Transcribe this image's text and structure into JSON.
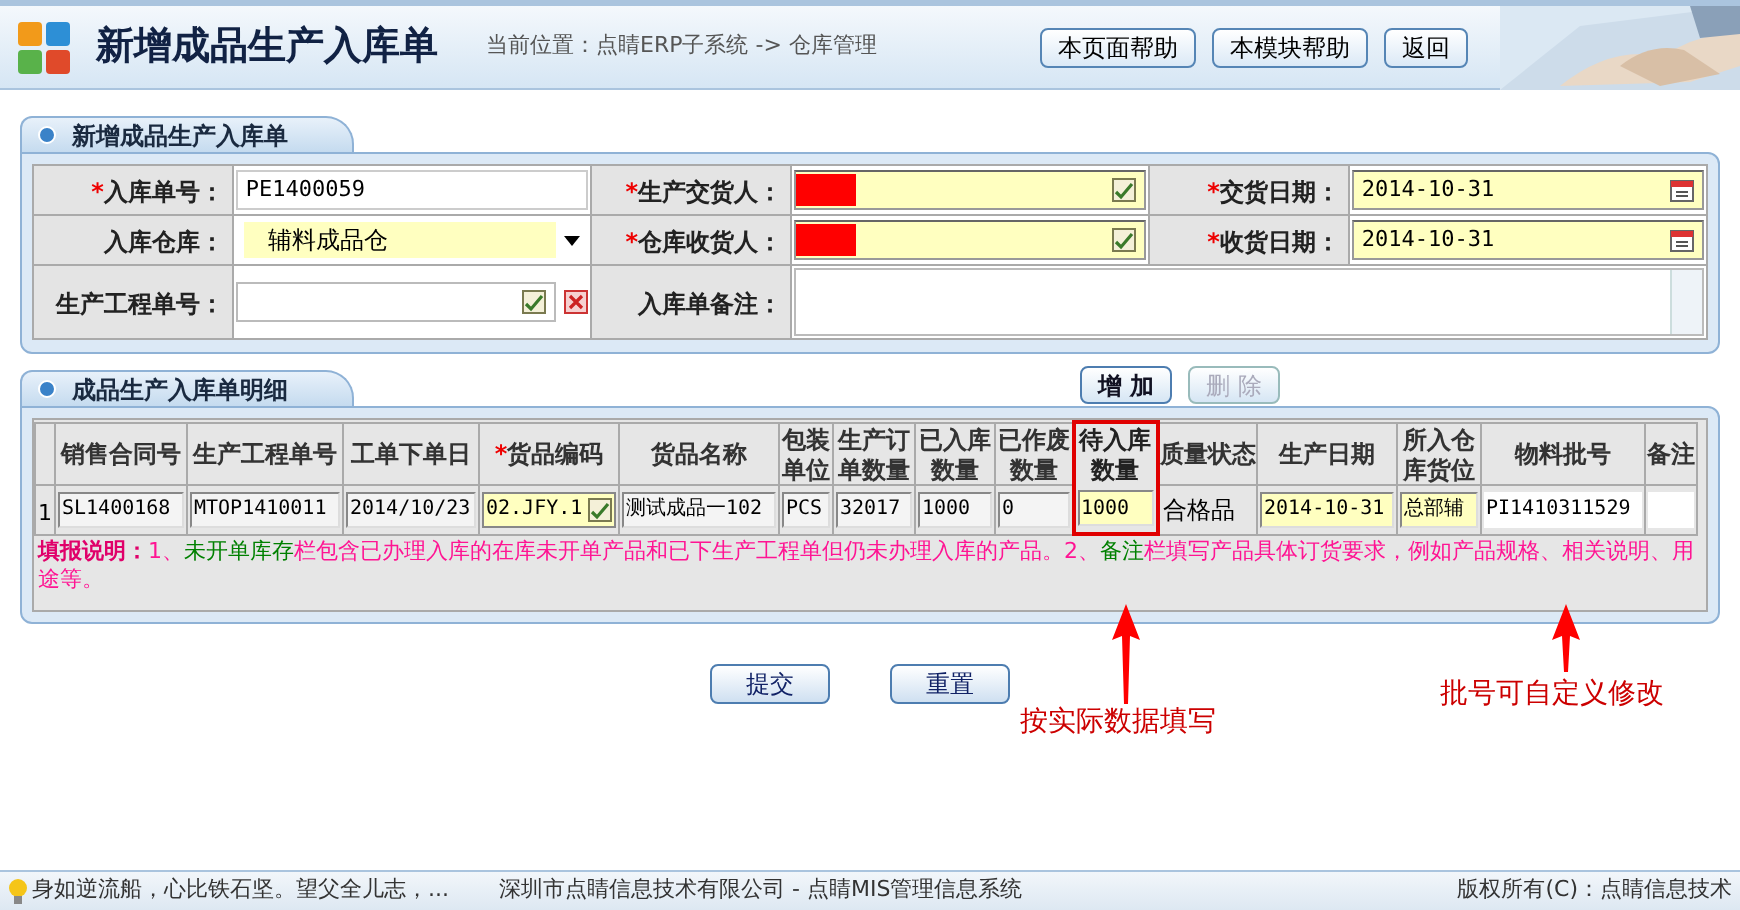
{
  "header": {
    "title": "新增成品生产入库单",
    "breadcrumb": "当前位置：点睛ERP子系统 -> 仓库管理",
    "buttons": [
      "本页面帮助",
      "本模块帮助",
      "返回"
    ]
  },
  "form_panel": {
    "title": "新增成品生产入库单",
    "rows": [
      [
        {
          "mark": "*",
          "label": "入库单号：",
          "kind": "text",
          "value": "PE1400059"
        },
        {
          "mark": "*",
          "label": "生产交货人：",
          "kind": "picker",
          "redacted": true
        },
        {
          "mark": "*",
          "label": "交货日期：",
          "kind": "date",
          "value": "2014-10-31"
        }
      ],
      [
        {
          "label": "入库仓库：",
          "kind": "select",
          "value": "辅料成品仓"
        },
        {
          "mark": "*",
          "label": "仓库收货人：",
          "kind": "picker",
          "redacted": true
        },
        {
          "mark": "*",
          "label": "收货日期：",
          "kind": "date",
          "value": "2014-10-31"
        }
      ],
      [
        {
          "label": "生产工程单号：",
          "kind": "lookup"
        },
        {
          "label": "入库单备注：",
          "kind": "textarea"
        }
      ]
    ]
  },
  "detail_panel": {
    "title": "成品生产入库单明细",
    "buttons": [
      {
        "label": "增 加",
        "disabled": false
      },
      {
        "label": "删 除",
        "disabled": true
      }
    ],
    "columns": [
      {
        "label": "销售合同号",
        "highlighted": false
      },
      {
        "label": "生产工程单号",
        "highlighted": false
      },
      {
        "label": "工单下单日",
        "highlighted": false
      },
      {
        "mark": "*",
        "label": "货品编码",
        "highlighted": false
      },
      {
        "label": "货品名称",
        "highlighted": false
      },
      {
        "label": "包装单位",
        "highlighted": false
      },
      {
        "label": "生产订单数量",
        "highlighted": false
      },
      {
        "label": "已入库数量",
        "highlighted": false
      },
      {
        "label": "已作废数量",
        "highlighted": false
      },
      {
        "label": "待入库数量",
        "highlighted": true
      },
      {
        "label": "质量状态",
        "highlighted": false
      },
      {
        "label": "生产日期",
        "highlighted": false
      },
      {
        "label": "所入仓库货位",
        "highlighted": false
      },
      {
        "label": "物料批号",
        "highlighted": false
      },
      {
        "label": "备注",
        "highlighted": false
      }
    ],
    "rows": [
      {
        "index": "1",
        "cells": [
          {
            "kind": "readonly",
            "value": "SL1400168"
          },
          {
            "kind": "readonly",
            "value": "MTOP1410011"
          },
          {
            "kind": "readonly",
            "value": "2014/10/23"
          },
          {
            "kind": "picker",
            "value": "02.JFY.1"
          },
          {
            "kind": "readonly",
            "value": "测试成品一102"
          },
          {
            "kind": "readonly",
            "value": "PCS"
          },
          {
            "kind": "readonly",
            "value": "32017"
          },
          {
            "kind": "readonly",
            "value": "1000"
          },
          {
            "kind": "readonly",
            "value": "0"
          },
          {
            "kind": "editable",
            "value": "1000"
          },
          {
            "kind": "plain",
            "value": "合格品"
          },
          {
            "kind": "editable",
            "value": "2014-10-31"
          },
          {
            "kind": "editable",
            "value": "总部辅"
          },
          {
            "kind": "white",
            "value": "PI1410311529"
          },
          {
            "kind": "white"
          }
        ]
      }
    ],
    "note": [
      {
        "kind": "label",
        "text": "填报说明："
      },
      {
        "kind": "text",
        "text": "1、"
      },
      {
        "kind": "key",
        "text": "未开单库存"
      },
      {
        "kind": "text",
        "text": "栏包含已办理入库的在库未开单产品和已下生产工程单但仍未办理入库的产品。2、"
      },
      {
        "kind": "key",
        "text": "备注"
      },
      {
        "kind": "text",
        "text": "栏填写产品具体订货要求，例如产品规格、相关说明、用途等。"
      }
    ]
  },
  "actions": [
    "提交",
    "重置"
  ],
  "annotations": [
    {
      "text": "按实际数据填写"
    },
    {
      "text": "批号可自定义修改"
    }
  ],
  "status_bar": {
    "tip": "身如逆流船，心比铁石坚。望父全儿志，...",
    "company": "深圳市点睛信息技术有限公司 - 点睛MIS管理信息系统",
    "copyright": "版权所有(C)：点睛信息技术"
  }
}
